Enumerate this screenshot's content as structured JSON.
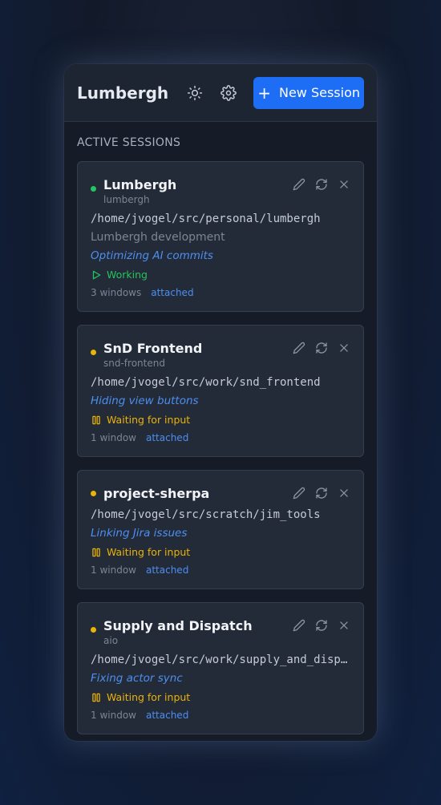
{
  "header": {
    "title": "Lumbergh",
    "new_session_label": "New Session"
  },
  "section_title": "ACTIVE SESSIONS",
  "colors": {
    "accent": "#1e6ef5",
    "working": "#22c55e",
    "waiting": "#eab308",
    "link": "#4d8ef0"
  },
  "sessions": [
    {
      "name": "Lumbergh",
      "slug": "lumbergh",
      "path": "/home/jvogel/src/personal/lumbergh",
      "description": "Lumbergh development",
      "task": "Optimizing AI commits",
      "status": "Working",
      "status_icon": "play-icon",
      "windows": "3 windows",
      "attached": "attached"
    },
    {
      "name": "SnD Frontend",
      "slug": "snd-frontend",
      "path": "/home/jvogel/src/work/snd_frontend",
      "task": "Hiding view buttons",
      "status": "Waiting for input",
      "status_icon": "pause-icon",
      "windows": "1 window",
      "attached": "attached"
    },
    {
      "name": "project-sherpa",
      "path": "/home/jvogel/src/scratch/jim_tools",
      "task": "Linking Jira issues",
      "status": "Waiting for input",
      "status_icon": "pause-icon",
      "windows": "1 window",
      "attached": "attached"
    },
    {
      "name": "Supply and Dispatch",
      "slug": "aio",
      "path": "/home/jvogel/src/work/supply_and_dispatch",
      "task": "Fixing actor sync",
      "status": "Waiting for input",
      "status_icon": "pause-icon",
      "windows": "1 window",
      "attached": "attached"
    }
  ]
}
